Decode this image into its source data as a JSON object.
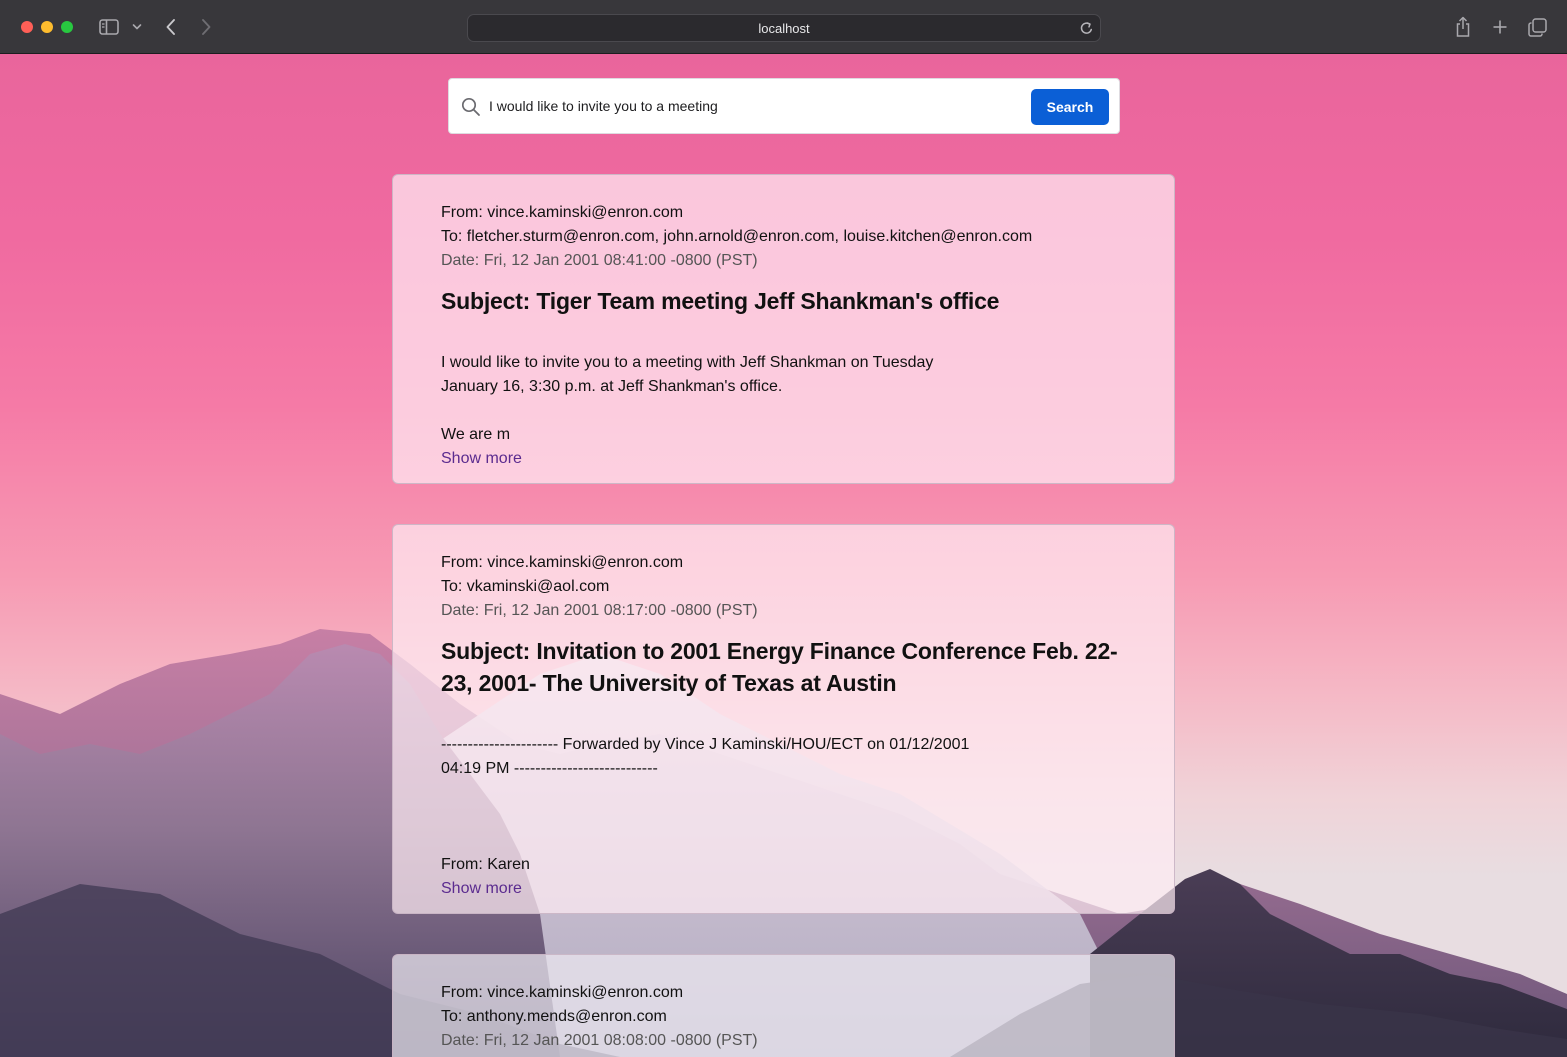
{
  "browser": {
    "url": "localhost"
  },
  "search": {
    "query": "I would like to invite you to a meeting",
    "button_label": "Search"
  },
  "results": [
    {
      "from": "From: vince.kaminski@enron.com",
      "to": "To: fletcher.sturm@enron.com, john.arnold@enron.com, louise.kitchen@enron.com",
      "date": "Date: Fri, 12 Jan 2001 08:41:00 -0800 (PST)",
      "subject": "Subject: Tiger Team meeting Jeff Shankman's office",
      "body": "I would like to invite you to a meeting with Jeff Shankman on Tuesday\nJanuary 16, 3:30 p.m. at Jeff Shankman's office.\n\nWe are m",
      "show_more": "Show more"
    },
    {
      "from": "From: vince.kaminski@enron.com",
      "to": "To: vkaminski@aol.com",
      "date": "Date: Fri, 12 Jan 2001 08:17:00 -0800 (PST)",
      "subject": "Subject: Invitation to 2001 Energy Finance Conference Feb. 22-23, 2001- The University of Texas at Austin",
      "body": "---------------------- Forwarded by Vince J Kaminski/HOU/ECT on 01/12/2001\n04:19 PM ---------------------------\n\n\n\nFrom: Karen",
      "show_more": "Show more"
    },
    {
      "from": "From: vince.kaminski@enron.com",
      "to": "To: anthony.mends@enron.com",
      "date": "Date: Fri, 12 Jan 2001 08:08:00 -0800 (PST)"
    }
  ]
}
